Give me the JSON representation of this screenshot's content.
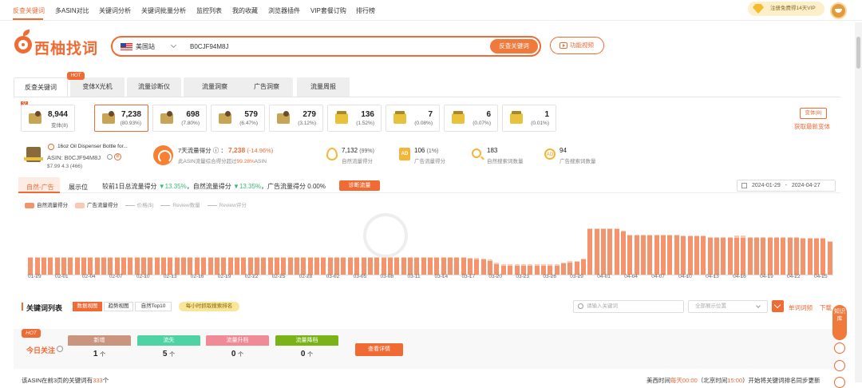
{
  "nav": {
    "items": [
      "反查关键词",
      "多ASIN对比",
      "关键词分析",
      "关键词批量分析",
      "监控列表",
      "我的收藏",
      "浏览器插件",
      "VIP套餐订购",
      "排行榜"
    ],
    "vip_label": "注册免费得14天VIP"
  },
  "logo": {
    "text": "西柚找词"
  },
  "search": {
    "site": "美国站",
    "asin_value": "B0CJF94M8J",
    "button": "反查关键词"
  },
  "video_button": "功能视频",
  "tabs": {
    "hot_badge": "HOT",
    "items": [
      "反查关键词",
      "变体X光机",
      "流量诊断仪",
      "流量洞察",
      "广告洞察",
      "流量周报"
    ]
  },
  "categories": {
    "corner_tag": "父",
    "items": [
      {
        "value": "8,944",
        "pct": "变体(8)"
      },
      {
        "value": "7,238",
        "pct": "(80.93%)"
      },
      {
        "value": "698",
        "pct": "(7.80%)"
      },
      {
        "value": "579",
        "pct": "(6.47%)"
      },
      {
        "value": "279",
        "pct": "(3.12%)"
      },
      {
        "value": "136",
        "pct": "(1.52%)"
      },
      {
        "value": "7",
        "pct": "(0.08%)"
      },
      {
        "value": "6",
        "pct": "(0.07%)"
      },
      {
        "value": "1",
        "pct": "(0.01%)"
      }
    ],
    "variant_button": "变体(8)",
    "variant_link": "获取最新变体"
  },
  "product": {
    "title": "16oz Oil Dispenser Bottle for...",
    "asin": "ASIN:  B0CJF94M8J",
    "b_badge": "B",
    "price": "$7.99  4.3 (466)"
  },
  "metrics": {
    "seven_day": {
      "label": "7天流量得分",
      "value": "7,238",
      "change": "(-14.96%)",
      "sub_pre": "此ASIN流量综合得分超过",
      "sub_hl": "99.28%",
      "sub_post": "ASIN"
    },
    "items": [
      {
        "icon": "drop-icon",
        "value": "7,132",
        "pct": "(99%)",
        "label": "自然流量得分"
      },
      {
        "icon": "ad-icon",
        "value": "106",
        "pct": "(1%)",
        "label": "广告流量得分"
      },
      {
        "icon": "search-count-icon",
        "value": "183",
        "pct": "",
        "label": "自然搜索词数量"
      },
      {
        "icon": "ad-search-count-icon",
        "value": "94",
        "pct": "",
        "label": "广告搜索词数量"
      }
    ],
    "ad_badge": "AD",
    "ad_circle": "AD"
  },
  "chart_panel": {
    "tabs": [
      "自然-广告",
      "展示位"
    ],
    "summary_pre": "较前1日总流量得分",
    "summary_v1": "▼13.35%",
    "summary_mid": "，自然流量得分",
    "summary_v2": "▼13.35%",
    "summary_post": "，广告流量得分 0.00%",
    "diagnose_btn": "诊断流量",
    "date_from": "2024-01-29",
    "date_sep": "-",
    "date_to": "2024-04-27"
  },
  "chart_data": {
    "type": "bar",
    "stacked": true,
    "legend_position": "top-left",
    "legend": [
      {
        "name": "自然流量得分",
        "color": "#f5946c",
        "active": true
      },
      {
        "name": "广告流量得分",
        "color": "#fbc9b1",
        "active": true
      },
      {
        "name": "价格($)",
        "active": false
      },
      {
        "name": "Review数量",
        "active": false
      },
      {
        "name": "Review评分",
        "active": false
      }
    ],
    "x_tick_labels": [
      "01-29",
      "02-01",
      "02-04",
      "02-07",
      "02-10",
      "02-13",
      "02-16",
      "02-19",
      "02-22",
      "02-25",
      "02-28",
      "03-02",
      "03-05",
      "03-08",
      "03-11",
      "03-14",
      "03-17",
      "03-20",
      "03-23",
      "03-26",
      "03-29",
      "04-01",
      "04-04",
      "04-07",
      "04-10",
      "04-13",
      "04-16",
      "04-19",
      "04-22",
      "04-25"
    ],
    "ylim": [
      0,
      1400
    ],
    "series": [
      {
        "name": "自然流量得分",
        "values": [
          360,
          360,
          360,
          360,
          360,
          360,
          360,
          360,
          360,
          360,
          360,
          360,
          360,
          360,
          360,
          360,
          360,
          360,
          360,
          360,
          360,
          360,
          360,
          360,
          360,
          360,
          360,
          360,
          360,
          360,
          360,
          360,
          360,
          360,
          360,
          360,
          360,
          360,
          360,
          360,
          360,
          360,
          360,
          360,
          360,
          360,
          360,
          360,
          360,
          360,
          360,
          360,
          360,
          360,
          360,
          360,
          360,
          360,
          360,
          360,
          360,
          360,
          360,
          360,
          360,
          360,
          350,
          340,
          330,
          300,
          230,
          200,
          200,
          200,
          200,
          200,
          200,
          200,
          200,
          200,
          240,
          270,
          280,
          330,
          1000,
          1000,
          1000,
          1000,
          1000,
          950,
          860,
          860,
          860,
          860,
          860,
          860,
          860,
          860,
          840,
          840,
          850,
          850,
          810,
          810,
          810,
          810,
          810,
          810,
          810,
          810,
          810,
          810,
          810,
          810,
          810,
          810,
          790,
          790,
          790,
          790,
          720
        ]
      },
      {
        "name": "广告流量得分",
        "values": [
          25,
          25,
          25,
          25,
          25,
          25,
          25,
          25,
          25,
          25,
          25,
          25,
          25,
          25,
          25,
          25,
          25,
          25,
          25,
          25,
          25,
          25,
          25,
          25,
          25,
          25,
          25,
          25,
          25,
          25,
          25,
          25,
          25,
          25,
          25,
          25,
          25,
          25,
          25,
          25,
          25,
          25,
          25,
          25,
          25,
          25,
          25,
          25,
          25,
          25,
          25,
          25,
          25,
          25,
          25,
          25,
          25,
          25,
          25,
          25,
          25,
          25,
          25,
          25,
          25,
          25,
          25,
          25,
          25,
          25,
          25,
          25,
          25,
          25,
          25,
          25,
          25,
          25,
          25,
          25,
          25,
          25,
          25,
          25,
          10,
          10,
          10,
          10,
          10,
          10,
          10,
          10,
          10,
          10,
          10,
          10,
          10,
          10,
          10,
          10,
          10,
          10,
          10,
          10,
          10,
          10,
          40,
          40,
          10,
          10,
          10,
          10,
          10,
          10,
          10,
          10,
          10,
          10,
          10,
          10,
          10
        ]
      }
    ]
  },
  "keywords": {
    "title": "关键词列表",
    "views": [
      "数据视图",
      "趋势视图",
      "自然Top10"
    ],
    "grab_btn": "每小时抓取搜索排名",
    "search_placeholder": "请输入关键词",
    "position_select": "全部展示位置",
    "link1": "单词词频",
    "link2": "下载"
  },
  "today": {
    "hot": "HOT",
    "title": "今日关注",
    "stats": [
      {
        "label": "新增",
        "value": "1",
        "unit": "个",
        "color": "#c9957f"
      },
      {
        "label": "流失",
        "value": "5",
        "unit": "个",
        "color": "#4fd3a4"
      },
      {
        "label": "流量升档",
        "value": "0",
        "unit": "个",
        "color": "#f08a94"
      },
      {
        "label": "流量降档",
        "value": "0",
        "unit": "个",
        "color": "#7ab317"
      }
    ],
    "detail_btn": "查看详情"
  },
  "footer": {
    "left_pre": "该ASIN在前3页的关键词有",
    "left_num": "333",
    "left_post": "个",
    "right_a": "美西时间",
    "right_b": "每天00:00",
    "right_c": "（北京时间",
    "right_d": "15:00",
    "right_e": "）开始将关键词排名同步更新"
  },
  "side": {
    "knowledge": "知识库"
  }
}
